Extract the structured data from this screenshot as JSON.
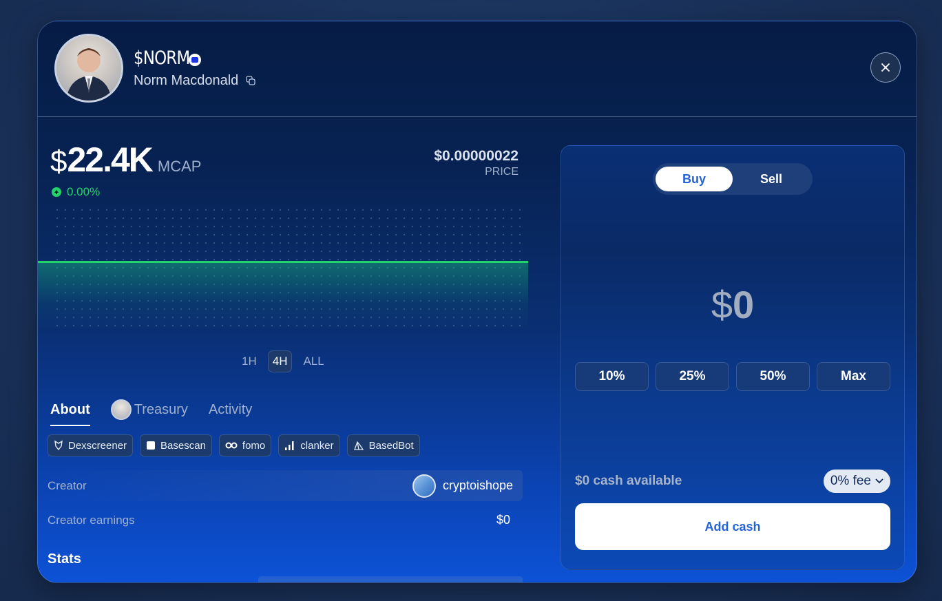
{
  "token": {
    "ticker": "$NORM",
    "name": "Norm Macdonald",
    "mcap_prefix": "$",
    "mcap_value": "22.4K",
    "mcap_unit": "MCAP",
    "change": "0.00%",
    "price": "$0.00000022",
    "price_label": "PRICE"
  },
  "chart": {
    "ranges": [
      "1H",
      "4H",
      "ALL"
    ],
    "active_range": "4H"
  },
  "tabs": [
    "About",
    "Treasury",
    "Activity"
  ],
  "links": [
    "Dexscreener",
    "Basescan",
    "fomo",
    "clanker",
    "BasedBot"
  ],
  "creator": {
    "label": "Creator",
    "username": "cryptoishope"
  },
  "earnings": {
    "label": "Creator earnings",
    "value": "$0"
  },
  "stats": {
    "heading": "Stats"
  },
  "trade": {
    "buy_label": "Buy",
    "sell_label": "Sell",
    "amount_symbol": "$",
    "amount_value": "0",
    "percents": [
      "10%",
      "25%",
      "50%",
      "Max"
    ],
    "cash_available": "$0 cash available",
    "fee": "0% fee",
    "add_cash": "Add cash"
  },
  "colors": {
    "accent_green": "#22d26a",
    "accent_blue": "#2563d8"
  }
}
